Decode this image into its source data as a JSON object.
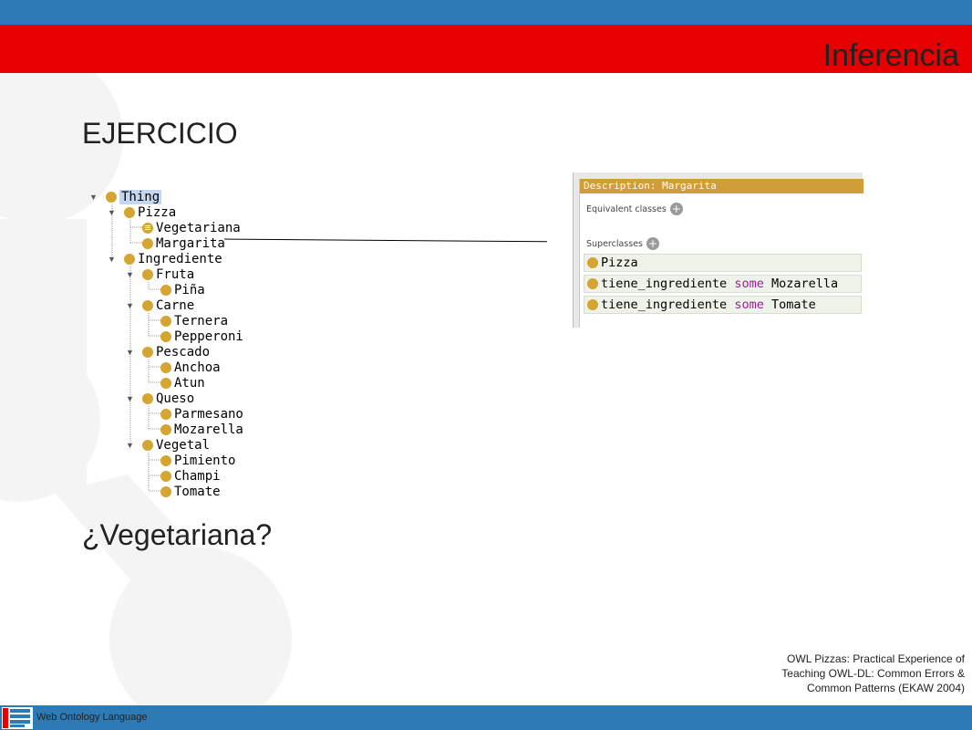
{
  "slide_title": "Inferencia",
  "heading": "EJERCICIO",
  "question": "¿Vegetariana?",
  "tree": {
    "nodes": [
      {
        "label": "Thing"
      },
      {
        "label": "Pizza"
      },
      {
        "label": "Vegetariana"
      },
      {
        "label": "Margarita"
      },
      {
        "label": "Ingrediente"
      },
      {
        "label": "Fruta"
      },
      {
        "label": "Piña"
      },
      {
        "label": "Carne"
      },
      {
        "label": "Ternera"
      },
      {
        "label": "Pepperoni"
      },
      {
        "label": "Pescado"
      },
      {
        "label": "Anchoa"
      },
      {
        "label": "Atun"
      },
      {
        "label": "Queso"
      },
      {
        "label": "Parmesano"
      },
      {
        "label": "Mozarella"
      },
      {
        "label": "Vegetal"
      },
      {
        "label": "Pimiento"
      },
      {
        "label": "Champi"
      },
      {
        "label": "Tomate"
      }
    ]
  },
  "description_panel": {
    "header": "Description: Margarita",
    "equivalent_label": "Equivalent classes",
    "superclasses_label": "Superclasses",
    "superclasses": [
      {
        "parts": [
          "Pizza"
        ]
      },
      {
        "parts": [
          "tiene_ingrediente",
          "some",
          "Mozarella"
        ]
      },
      {
        "parts": [
          "tiene_ingrediente",
          "some",
          "Tomate"
        ]
      }
    ]
  },
  "citation": "OWL Pizzas: Practical Experience of Teaching OWL-DL: Common Errors & Common Patterns (EKAW 2004)",
  "footer": "Web Ontology Language",
  "colors": {
    "top_bar": "#2d7ab4",
    "title_bar": "#e60000",
    "class_dot": "#d4a531",
    "header": "#cf9e38",
    "keyword": "#a0189a"
  }
}
